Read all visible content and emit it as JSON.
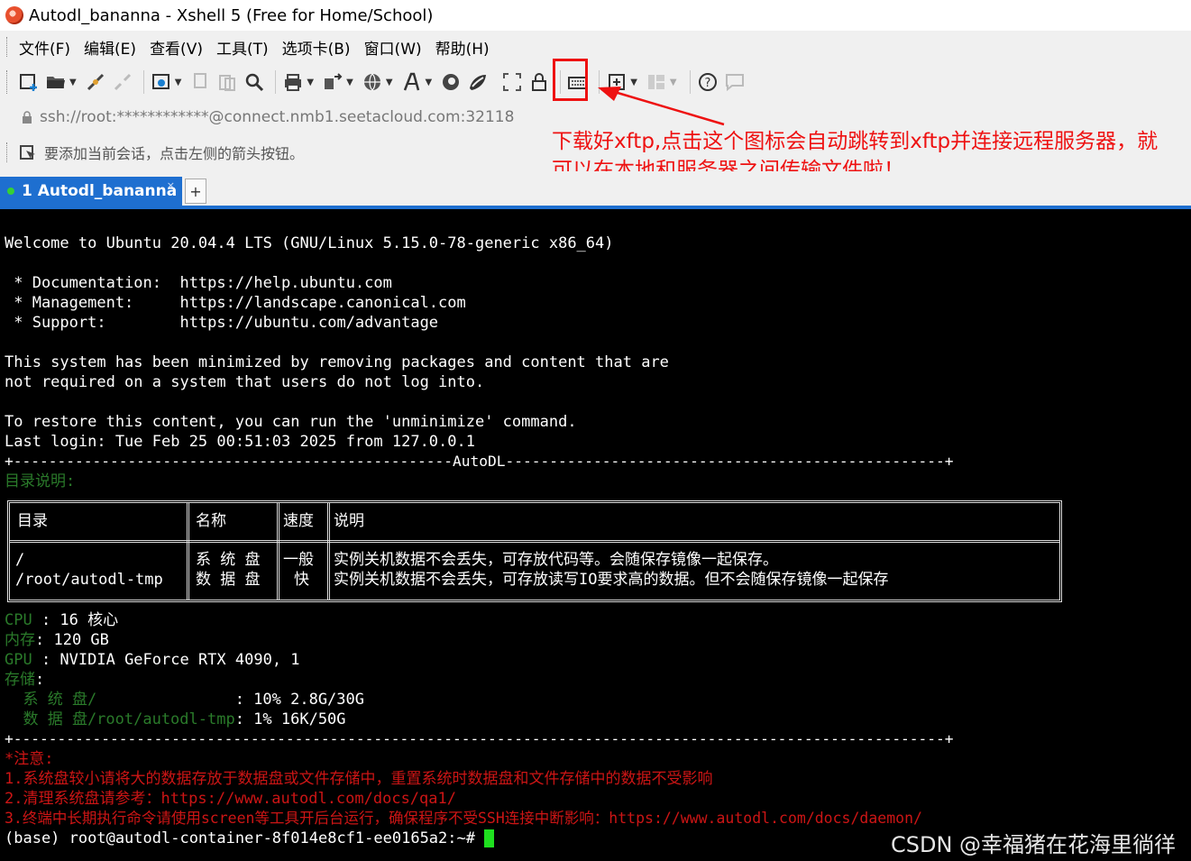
{
  "window": {
    "title": "Autodl_bananna - Xshell 5 (Free for Home/School)"
  },
  "menu": [
    "文件(F)",
    "编辑(E)",
    "查看(V)",
    "工具(T)",
    "选项卡(B)",
    "窗口(W)",
    "帮助(H)"
  ],
  "toolbar": {
    "icons": [
      "new-session-icon",
      "open-folder-icon",
      "reconnect-icon",
      "disconnect-icon",
      "properties-icon",
      "copy-icon",
      "paste-icon",
      "find-icon",
      "print-icon",
      "transfer-icon",
      "globe-icon",
      "font-icon",
      "xshell-icon",
      "xftp-icon",
      "fullscreen-icon",
      "lock-icon",
      "keyboard-icon",
      "add-icon",
      "layout-icon",
      "help-icon",
      "chat-icon"
    ]
  },
  "address": {
    "value": "ssh://root:************@connect.nmb1.seetacloud.com:32118"
  },
  "infobar": {
    "text": "要添加当前会话，点击左侧的箭头按钮。"
  },
  "tab": {
    "label": "1 Autodl_bananna",
    "add": "+",
    "close": "×"
  },
  "annotation": {
    "line1": "下载好xftp,点击这个图标会自动跳转到xftp并连接远程服务器，就",
    "line2": "可以在本地和服务器之间传输文件啦！",
    "color": "#ee1111"
  },
  "terminal": {
    "welcome": "Welcome to Ubuntu 20.04.4 LTS (GNU/Linux 5.15.0-78-generic x86_64)",
    "doc": " * Documentation:  https://help.ubuntu.com",
    "mgmt": " * Management:     https://landscape.canonical.com",
    "support": " * Support:        https://ubuntu.com/advantage",
    "min1": "This system has been minimized by removing packages and content that are",
    "min2": "not required on a system that users do not log into.",
    "restore": "To restore this content, you can run the 'unminimize' command.",
    "lastlogin": "Last login: Tue Feb 25 00:51:03 2025 from 127.0.0.1",
    "rule_autodl": "+--------------------------------------------------AutoDL--------------------------------------------------+",
    "dir_label": "目录说明:",
    "table": {
      "headers": [
        "目录",
        "名称",
        "速度",
        "说明"
      ],
      "rows": [
        [
          "/",
          "系 统 盘",
          "一般",
          "实例关机数据不会丢失，可存放代码等。会随保存镜像一起保存。"
        ],
        [
          "/root/autodl-tmp",
          "数 据 盘",
          "快",
          "实例关机数据不会丢失，可存放读写IO要求高的数据。但不会随保存镜像一起保存"
        ]
      ]
    },
    "cpu_label": "CPU",
    "cpu_value": " : 16 核心",
    "mem_label": "内存",
    "mem_value": ": 120 GB",
    "gpu_label": "GPU",
    "gpu_value": " : NVIDIA GeForce RTX 4090, 1",
    "storage_label": "存储",
    "storage_colon": ":",
    "sys_disk_label": "  系 统 盘/               ",
    "sys_disk_value": ": 10% 2.8G/30G",
    "data_disk_label": "  数 据 盘/root/autodl-tmp",
    "data_disk_value": ": 1% 16K/50G",
    "rule_plain": "+----------------------------------------------------------------------------------------------------------+",
    "notice_title": "*注意:",
    "notice1": "1.系统盘较小请将大的数据存放于数据盘或文件存储中，重置系统时数据盘和文件存储中的数据不受影响",
    "notice2": "2.清理系统盘请参考：https://www.autodl.com/docs/qa1/",
    "notice3": "3.终端中长期执行命令请使用screen等工具开后台运行，确保程序不受SSH连接中断影响：https://www.autodl.com/docs/daemon/",
    "prompt": "(base) root@autodl-container-8f014e8cf1-ee0165a2:~# "
  },
  "watermark": "CSDN @幸福猪在花海里徜徉"
}
